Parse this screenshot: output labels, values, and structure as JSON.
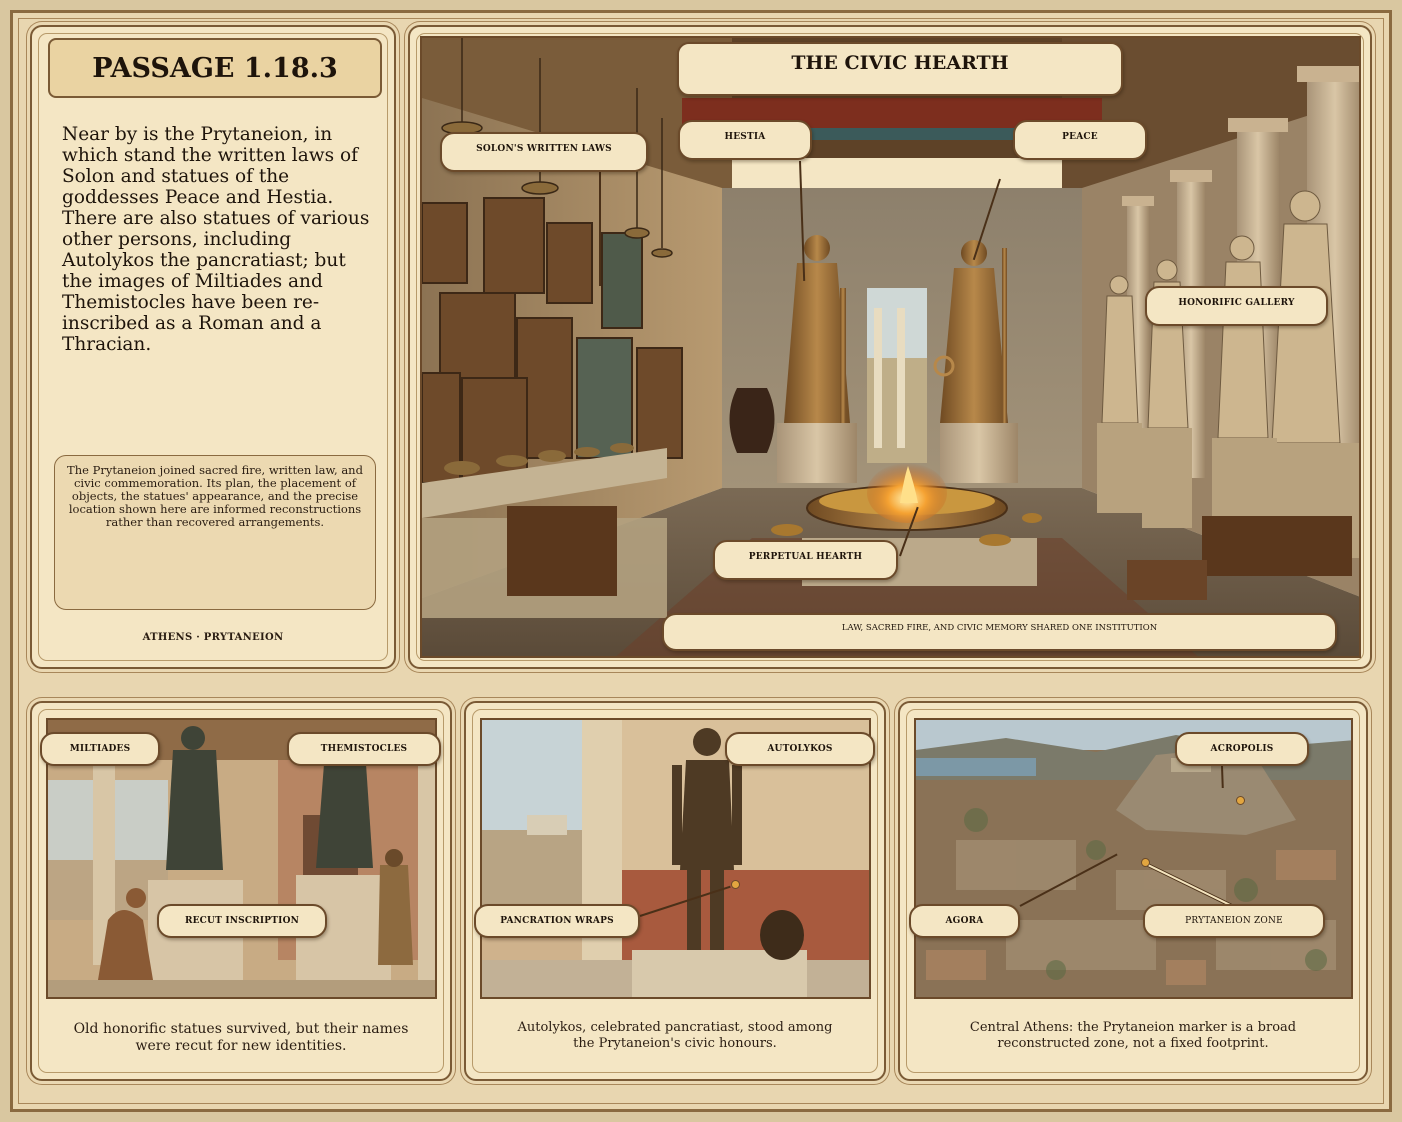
{
  "passage": {
    "title": "PASSAGE 1.18.3",
    "text": "Near by is the Prytaneion, in which stand the written laws of Solon and statues of the goddesses Peace and Hestia. There are also statues of various other persons, including Autolykos the pancratiast; but the images of Miltiades and Themistocles have been re-inscribed as a Roman and a Thracian.",
    "note": "The Prytaneion joined sacred fire, written law, and civic commemoration. Its plan, the placement of objects, the statues' appearance, and the precise location shown here are informed reconstructions rather than recovered arrangements.",
    "footer": "ATHENS · PRYTANEION"
  },
  "hearth_panel": {
    "title": "THE CIVIC HEARTH",
    "labels": {
      "solon": "SOLON'S WRITTEN LAWS",
      "hestia": "HESTIA",
      "peace": "PEACE",
      "gallery": "HONORIFIC GALLERY",
      "hearth": "PERPETUAL HEARTH"
    },
    "caption": "LAW, SACRED FIRE, AND CIVIC MEMORY SHARED ONE INSTITUTION"
  },
  "panel_statues": {
    "labels": {
      "miltiades": "MILTIADES",
      "themistocles": "THEMISTOCLES",
      "recut": "RECUT INSCRIPTION"
    },
    "caption": "Old honorific statues survived, but their names were recut for new identities."
  },
  "panel_autolykos": {
    "labels": {
      "autolykos": "AUTOLYKOS",
      "wraps": "PANCRATION WRAPS"
    },
    "caption": "Autolykos, celebrated pancratiast, stood among the Prytaneion's civic honours."
  },
  "panel_map": {
    "labels": {
      "acropolis": "ACROPOLIS",
      "agora": "AGORA",
      "prytaneion": "PRYTANEION ZONE"
    },
    "caption": "Central Athens: the Prytaneion marker is a broad reconstructed zone, not a fixed footprint."
  },
  "colors": {
    "parchment": "#f4e6c4",
    "ink": "#2a1d12",
    "border": "#7a5a35",
    "marker": "#e2a640"
  }
}
